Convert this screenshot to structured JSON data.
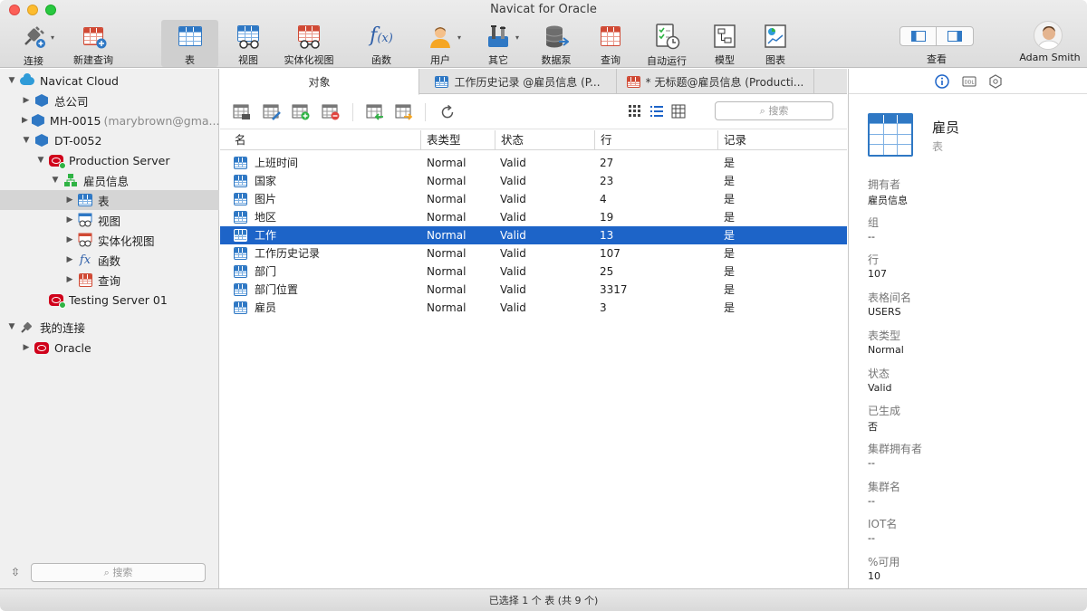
{
  "window": {
    "title": "Navicat for Oracle"
  },
  "toolbar": {
    "items": [
      {
        "label": "连接",
        "icon": "connection-plug-icon"
      },
      {
        "label": "新建查询",
        "icon": "new-query-icon"
      },
      {
        "label": "表",
        "icon": "table-icon",
        "active": true
      },
      {
        "label": "视图",
        "icon": "view-icon"
      },
      {
        "label": "实体化视图",
        "icon": "materialized-view-icon"
      },
      {
        "label": "函数",
        "icon": "function-icon"
      },
      {
        "label": "用户",
        "icon": "user-icon"
      },
      {
        "label": "其它",
        "icon": "tools-icon"
      },
      {
        "label": "数据泵",
        "icon": "data-pump-icon"
      },
      {
        "label": "查询",
        "icon": "query-icon"
      },
      {
        "label": "自动运行",
        "icon": "automation-icon"
      },
      {
        "label": "模型",
        "icon": "model-icon"
      },
      {
        "label": "图表",
        "icon": "chart-icon"
      }
    ],
    "view_label": "查看",
    "user_name": "Adam Smith"
  },
  "sidebar": {
    "tree": [
      {
        "label": "Navicat Cloud",
        "icon": "cloud-icon"
      },
      {
        "label": "总公司",
        "icon": "project-icon"
      },
      {
        "label": "MH-0015",
        "suffix": "(marybrown@gma...",
        "icon": "project-icon"
      },
      {
        "label": "DT-0052",
        "icon": "project-icon"
      },
      {
        "label": "Production Server",
        "icon": "oracle-server-icon"
      },
      {
        "label": "雇员信息",
        "icon": "schema-icon"
      },
      {
        "label": "表",
        "icon": "table-icon"
      },
      {
        "label": "视图",
        "icon": "view-icon"
      },
      {
        "label": "实体化视图",
        "icon": "materialized-view-icon"
      },
      {
        "label": "函数",
        "icon": "function-icon"
      },
      {
        "label": "查询",
        "icon": "query-icon"
      },
      {
        "label": "Testing Server 01",
        "icon": "oracle-server-icon"
      },
      {
        "label": "我的连接",
        "icon": "connection-plug-icon"
      },
      {
        "label": "Oracle",
        "icon": "oracle-server-icon"
      }
    ],
    "search_placeholder": "搜索"
  },
  "tabs": [
    {
      "label": "对象"
    },
    {
      "label": "工作历史记录 @雇员信息 (P..."
    },
    {
      "label": "* 无标题@雇员信息 (Producti..."
    }
  ],
  "object_search_placeholder": "搜索",
  "grid": {
    "columns": [
      "名",
      "表类型",
      "状态",
      "行",
      "记录"
    ],
    "rows": [
      [
        "上班时间",
        "Normal",
        "Valid",
        "27",
        "是"
      ],
      [
        "国家",
        "Normal",
        "Valid",
        "23",
        "是"
      ],
      [
        "图片",
        "Normal",
        "Valid",
        "4",
        "是"
      ],
      [
        "地区",
        "Normal",
        "Valid",
        "19",
        "是"
      ],
      [
        "工作",
        "Normal",
        "Valid",
        "13",
        "是"
      ],
      [
        "工作历史记录",
        "Normal",
        "Valid",
        "107",
        "是"
      ],
      [
        "部门",
        "Normal",
        "Valid",
        "25",
        "是"
      ],
      [
        "部门位置",
        "Normal",
        "Valid",
        "3317",
        "是"
      ],
      [
        "雇员",
        "Normal",
        "Valid",
        "3",
        "是"
      ]
    ],
    "selected_row": 4
  },
  "info": {
    "title": "雇员",
    "subtitle": "表",
    "fields": [
      {
        "key": "拥有者",
        "value": "雇员信息"
      },
      {
        "key": "组",
        "value": "--"
      },
      {
        "key": "行",
        "value": "107"
      },
      {
        "key": "表格间名",
        "value": "USERS"
      },
      {
        "key": "表类型",
        "value": "Normal"
      },
      {
        "key": "状态",
        "value": "Valid"
      },
      {
        "key": "已生成",
        "value": "否"
      },
      {
        "key": "集群拥有者",
        "value": "--"
      },
      {
        "key": "集群名",
        "value": "--"
      },
      {
        "key": "IOT名",
        "value": "--"
      },
      {
        "key": "%可用",
        "value": "10"
      }
    ]
  },
  "status": {
    "text": "已选择 1 个 表 (共 9 个)"
  },
  "colors": {
    "accent": "#1d64c8",
    "oracle_red": "#d0021b",
    "table_blue": "#2f78c4"
  }
}
